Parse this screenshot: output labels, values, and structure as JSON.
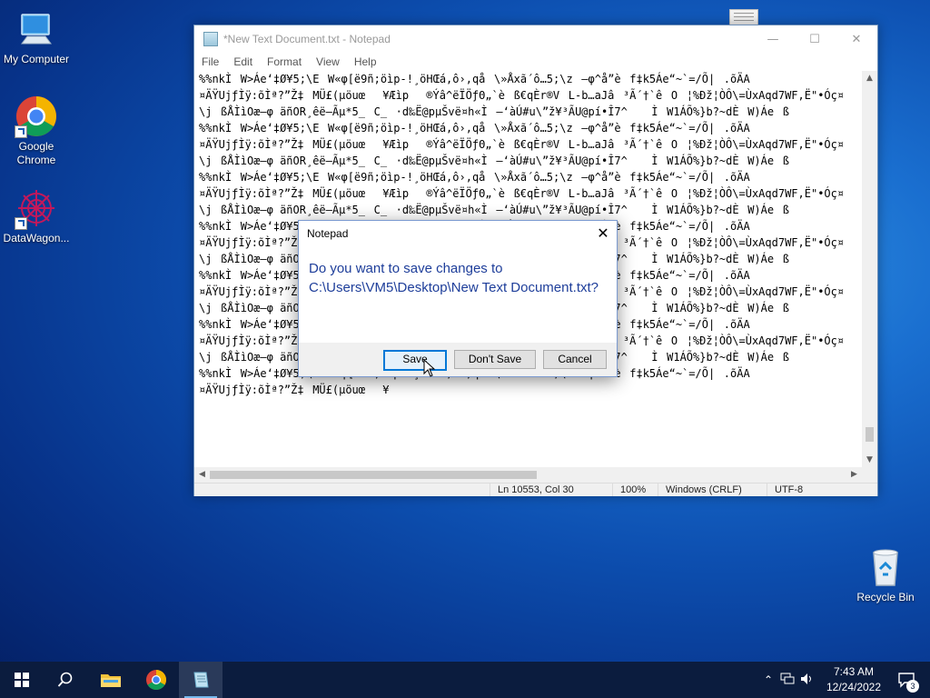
{
  "desktop": {
    "icons": [
      {
        "label": "My Computer",
        "icon": "computer-icon"
      },
      {
        "label": "Google Chrome",
        "icon": "chrome-icon"
      },
      {
        "label": "DataWagon...",
        "icon": "datawagon-icon"
      },
      {
        "label": "Recycle Bin",
        "icon": "recycle-bin-icon"
      }
    ]
  },
  "notepad": {
    "title": "*New Text Document.txt - Notepad",
    "menu": [
      "File",
      "Edit",
      "Format",
      "View",
      "Help"
    ],
    "lines": [
      "%%nkÌW>Áe‘‡Ø­¥5;\\EW«φ[ë9ñ;öìp-!¸öHŒá,ô›,qå\\»Åxã´ô…5;\\z—φ^å”èf‡k5Áe“~`=/Õ|.õÄA",
      "¤ÄŸUjƒÌÿ:õÌª?”Ž‡MÜ£(µöuœ¥Æìp®Ýâ^ëÏÖƒΘ„`èß€qÈr®VL-b…aJâ³Ã´†`êO¦%Ðž¦ÒÔ\\=ÙxAqd7WF,Ë\"•Óç¤",
      "\\jßÅÌìOæ—φ äñOR¸êë—Ãµ*5_C_·d‰Ë@pµŠvë¤h«Ì—‘àÚ#u\\”ž¥³ÃU@pí•Î7^ ÌW1ÁÕ%}b?~dÈW)Áeß",
      "%%nkÌW>Áe‘‡Ø­¥5;\\EW«φ[ë9ñ;öìp-!¸öHŒá,ô›,qå\\»Åxã´ô…5;\\z—φ^å”èf‡k5Áe“~`=/Õ|.õÄA",
      "¤ÄŸUjƒÌÿ:õÌª?”Ž‡MÜ£(µöuœ¥Æìp®Ýâ^ëÏÖƒΘ„`èß€qÈr®VL-b…aJâ³Ã´†`êO¦%Ðž¦ÒÔ\\=ÙxAqd7WF,Ë\"•Óç¤",
      "\\jßÅÌìOæ—φ äñOR¸êë—Ãµ*5_C_·d‰Ë@pµŠvë¤h«Ì—‘àÚ#u\\”ž¥³ÃU@pí•Î7^ ÌW1ÁÕ%}b?~dÈW)Áeß",
      "%%nkÌW>Áe‘‡Ø­¥5;\\EW«φ[ë9ñ;öìp-!¸öHŒá,ô›,qå\\»Åxã´ô…5;\\z—φ^å”èf‡k5Áe“~`=/Õ|.õÄA",
      "¤ÄŸUjƒÌÿ:õÌª?”Ž‡MÜ£(µöuœ¥Æìp®Ýâ^ëÏÖƒΘ„`èß€qÈr®VL-b…aJâ³Ã´†`êO¦%Ðž¦ÒÔ\\=ÙxAqd7WF,Ë\"•Óç¤",
      "\\jßÅÌìOæ—φ äñOR¸êë—Ãµ*5_C_·d‰Ë@pµŠvë¤h«Ì—‘àÚ#u\\”ž¥³ÃU@pí•Î7^ ÌW1ÁÕ%}b?~dÈW)Áeß",
      "%%nkÌW>Áe‘‡Ø­¥5;\\EW«φ[ë9ñ;öìp-!¸öHŒá,ô›,qå\\»Åxã´ô…5;\\z—φ^å”èf‡k5Áe“~`=/Õ|.õÄA",
      "¤ÄŸUjƒÌÿ:õÌª?”Ž‡MÜ£(µöuœ¥Æìp®Ýâ^ëÏÖƒΘ„`èß€qÈr®VL-b…aJâ³Ã´†`êO¦%Ðž¦ÒÔ\\=ÙxAqd7WF,Ë\"•Óç¤",
      "\\jßÅÌìOæ—φ äñOR¸êë—Ãµ*5_C_·d‰Ë@pµŠvë¤h«Ì—‘àÚ#u\\”ž¥³ÃU@pí•Î7^ ÌW1ÁÕ%}b?~dÈW)Áeß",
      "%%nkÌW>Áe‘‡Ø­¥5;\\EW«φ[ë9ñ;öìp-!¸öHŒá,ô›,qå\\»Åxã´ô…5;\\z—φ^å”èf‡k5Áe“~`=/Õ|.õÄA",
      "¤ÄŸUjƒÌÿ:õÌª?”Ž‡MÜ£(µöuœ¥Æìp®Ýâ^ëÏÖƒΘ„`èß€qÈr®VL-b…aJâ³Ã´†`êO¦%Ðž¦ÒÔ\\=ÙxAqd7WF,Ë\"•Óç¤",
      "\\jßÅÌìOæ—φ äñOR¸êë—Ãµ*5_C_·d‰Ë@pµŠvë¤h«Ì—‘àÚ#u\\”ž¥³ÃU@pí•Î7^ ÌW1ÁÕ%}b?~dÈW)Áeß",
      "%%nkÌW>Áe‘‡Ø­¥5;\\EW«φ[ë9ñ;öìp-!¸öHŒá,ô›,qå\\»Åxã´ô…5;\\z—φ^å”èf‡k5Áe“~`=/Õ|.õÄA",
      "¤ÄŸUjƒÌÿ:õÌª?”Ž‡MÜ£(µöuœ¥Æìp®Ýâ^ëÏÖƒΘ„`èß€qÈr®VL-b…aJâ³Ã´†`êO¦%Ðž¦ÒÔ\\=ÙxAqd7WF,Ë\"•Óç¤",
      "\\jßÅÌìOæ—φ äñOR¸êë—Ãµ*5_C_·d‰Ë@pµŠvë¤h«Ì—‘àÚ#u\\”ž¥³ÃU@pí•Î7^ ÌW1ÁÕ%}b?~dÈW)Áeß",
      "%%nkÌW>Áe‘‡Ø­¥5;\\EW«φ[ë9ñ;öìp-!¸öHŒá,ô›,qå\\»Åxã´ô…5;\\z—φ^å”èf‡k5Áe“~`=/Õ|.õÄA",
      "¤ÄŸUjƒÌÿ:õÌª?”Ž‡MÜ£(µöuœ¥"
    ],
    "status": {
      "position": "Ln 10553, Col 30",
      "zoom": "100%",
      "line_ending": "Windows (CRLF)",
      "encoding": "UTF-8"
    }
  },
  "dialog": {
    "title": "Notepad",
    "message": "Do you want to save changes to C:\\Users\\VM5\\Desktop\\New Text Document.txt?",
    "buttons": {
      "save": "Save",
      "dont_save": "Don't Save",
      "cancel": "Cancel"
    }
  },
  "taskbar": {
    "time": "7:43 AM",
    "date": "12/24/2022",
    "notification_count": "3",
    "apps": [
      "start-icon",
      "search-icon",
      "file-explorer-icon",
      "chrome-icon",
      "notepad-icon"
    ]
  },
  "colors": {
    "accent": "#0078d7",
    "dialog_text": "#1e3e9a",
    "taskbar": "#0b1c3e"
  }
}
